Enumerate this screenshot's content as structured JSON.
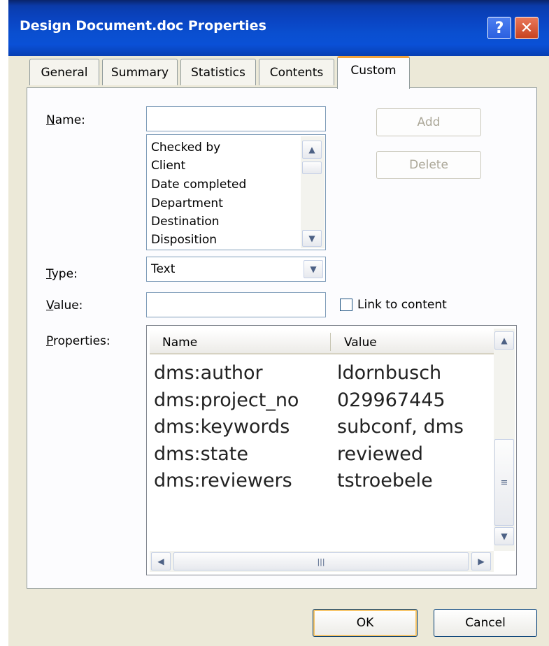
{
  "window": {
    "title": "Design Document.doc Properties"
  },
  "caption_buttons": {
    "help": "?",
    "close": "✕"
  },
  "tabs": [
    {
      "label": "General"
    },
    {
      "label": "Summary"
    },
    {
      "label": "Statistics"
    },
    {
      "label": "Contents"
    },
    {
      "label": "Custom",
      "selected": true
    }
  ],
  "form": {
    "name_label": "Name:",
    "name_value": "",
    "name_list": [
      "Checked by",
      "Client",
      "Date completed",
      "Department",
      "Destination",
      "Disposition"
    ],
    "add_label": "Add",
    "delete_label": "Delete",
    "type_label": "Type:",
    "type_value": "Text",
    "value_label": "Value:",
    "value_value": "",
    "link_label": "Link to content",
    "link_checked": false,
    "properties_label": "Properties:"
  },
  "properties_table": {
    "headers": [
      "Name",
      "Value"
    ],
    "rows": [
      {
        "name": "dms:author",
        "value": "ldornbusch"
      },
      {
        "name": "dms:project_no",
        "value": "029967445"
      },
      {
        "name": "dms:keywords",
        "value": "subconf, dms"
      },
      {
        "name": "dms:state",
        "value": "reviewed"
      },
      {
        "name": "dms:reviewers",
        "value": "tstroebele"
      }
    ]
  },
  "footer": {
    "ok_label": "OK",
    "cancel_label": "Cancel"
  },
  "colors": {
    "titlebar": "#0a4fd0",
    "tab_highlight": "#f3a33b",
    "dialog_bg": "#ece9d8",
    "close_button": "#d4522c"
  }
}
